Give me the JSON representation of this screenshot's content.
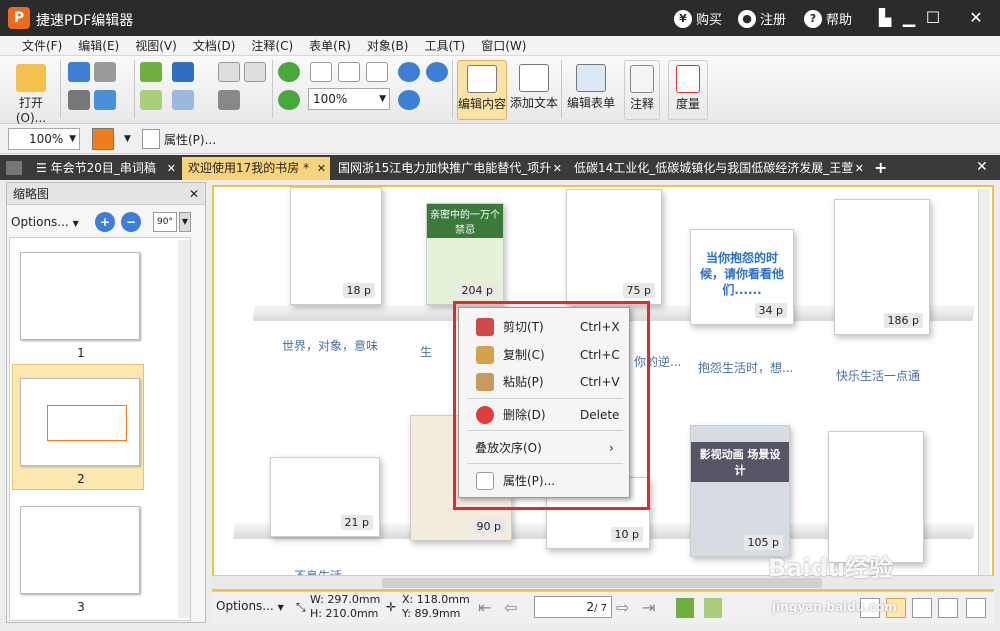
{
  "titlebar": {
    "title": "捷速PDF编辑器",
    "logo": "P",
    "buy": "购买",
    "register": "注册",
    "help": "帮助",
    "buy_icon": "¥",
    "help_icon": "?"
  },
  "menubar": {
    "items": [
      "文件(F)",
      "编辑(E)",
      "视图(V)",
      "文档(D)",
      "注释(C)",
      "表单(R)",
      "对象(B)",
      "工具(T)",
      "窗口(W)"
    ]
  },
  "toolbar": {
    "open": "打开(O)...",
    "zoom": "100%",
    "edit_content": "编辑内容",
    "add_text": "添加文本",
    "edit_form": "编辑表单",
    "annotate": "注释",
    "measure": "度量"
  },
  "toolbar2": {
    "zoom": "100%",
    "properties": "属性(P)..."
  },
  "tabs": [
    {
      "label": "年会节20目_串词稿"
    },
    {
      "label": "欢迎使用17我的书房 *"
    },
    {
      "label": "国网浙15江电力加快推广电能替代_项升"
    },
    {
      "label": "低碳14工业化_低碳城镇化与我国低碳经济发展_王萱"
    }
  ],
  "thumbnails": {
    "title": "缩略图",
    "options": "Options...",
    "rotate": "90°",
    "pages": [
      "1",
      "2",
      "3"
    ]
  },
  "viewer": {
    "books_top": [
      {
        "page": "18 p"
      },
      {
        "page": "204 p"
      },
      {
        "page": "75 p"
      },
      {
        "page": "34 p"
      },
      {
        "page": "186 p"
      }
    ],
    "books_bottom": [
      {
        "page": "21 p"
      },
      {
        "page": "90 p"
      },
      {
        "page": "10 p"
      },
      {
        "page": "105 p"
      }
    ],
    "shelf_labels_top": [
      "世界，对象，意味",
      "生",
      "你的逆...",
      "抱怨生活时，想...",
      "快乐生活一点通"
    ],
    "shelf_labels_bottom": [
      "不息生活"
    ],
    "book_cover_text": [
      "亲密中的一万个禁忌",
      "当你抱怨的时候，请你看看他们......",
      "影视动画 场景设计"
    ]
  },
  "context_menu": {
    "items": [
      {
        "label": "剪切(T)",
        "shortcut": "Ctrl+X",
        "icon": "scissors-icon"
      },
      {
        "label": "复制(C)",
        "shortcut": "Ctrl+C",
        "icon": "copy-icon"
      },
      {
        "label": "粘贴(P)",
        "shortcut": "Ctrl+V",
        "icon": "paste-icon"
      },
      {
        "label": "删除(D)",
        "shortcut": "Delete",
        "icon": "delete-icon"
      },
      {
        "label": "叠放次序(O)",
        "shortcut": "›",
        "icon": ""
      },
      {
        "label": "属性(P)...",
        "shortcut": "",
        "icon": "properties-icon"
      }
    ]
  },
  "statusbar": {
    "options": "Options...",
    "width": "W: 297.0mm",
    "height": "H: 210.0mm",
    "x": "X: 118.0mm",
    "y": "Y:   89.9mm",
    "page": "2",
    "page_total": "/ 7"
  },
  "watermark": {
    "brand": "Baidu经验",
    "url": "jingyan.baidu.com"
  },
  "colors": {
    "titlebar": "#2b2b2b",
    "accent": "#f06a1d",
    "active_tab": "#f7d37a",
    "highlight": "#e02b2b"
  }
}
